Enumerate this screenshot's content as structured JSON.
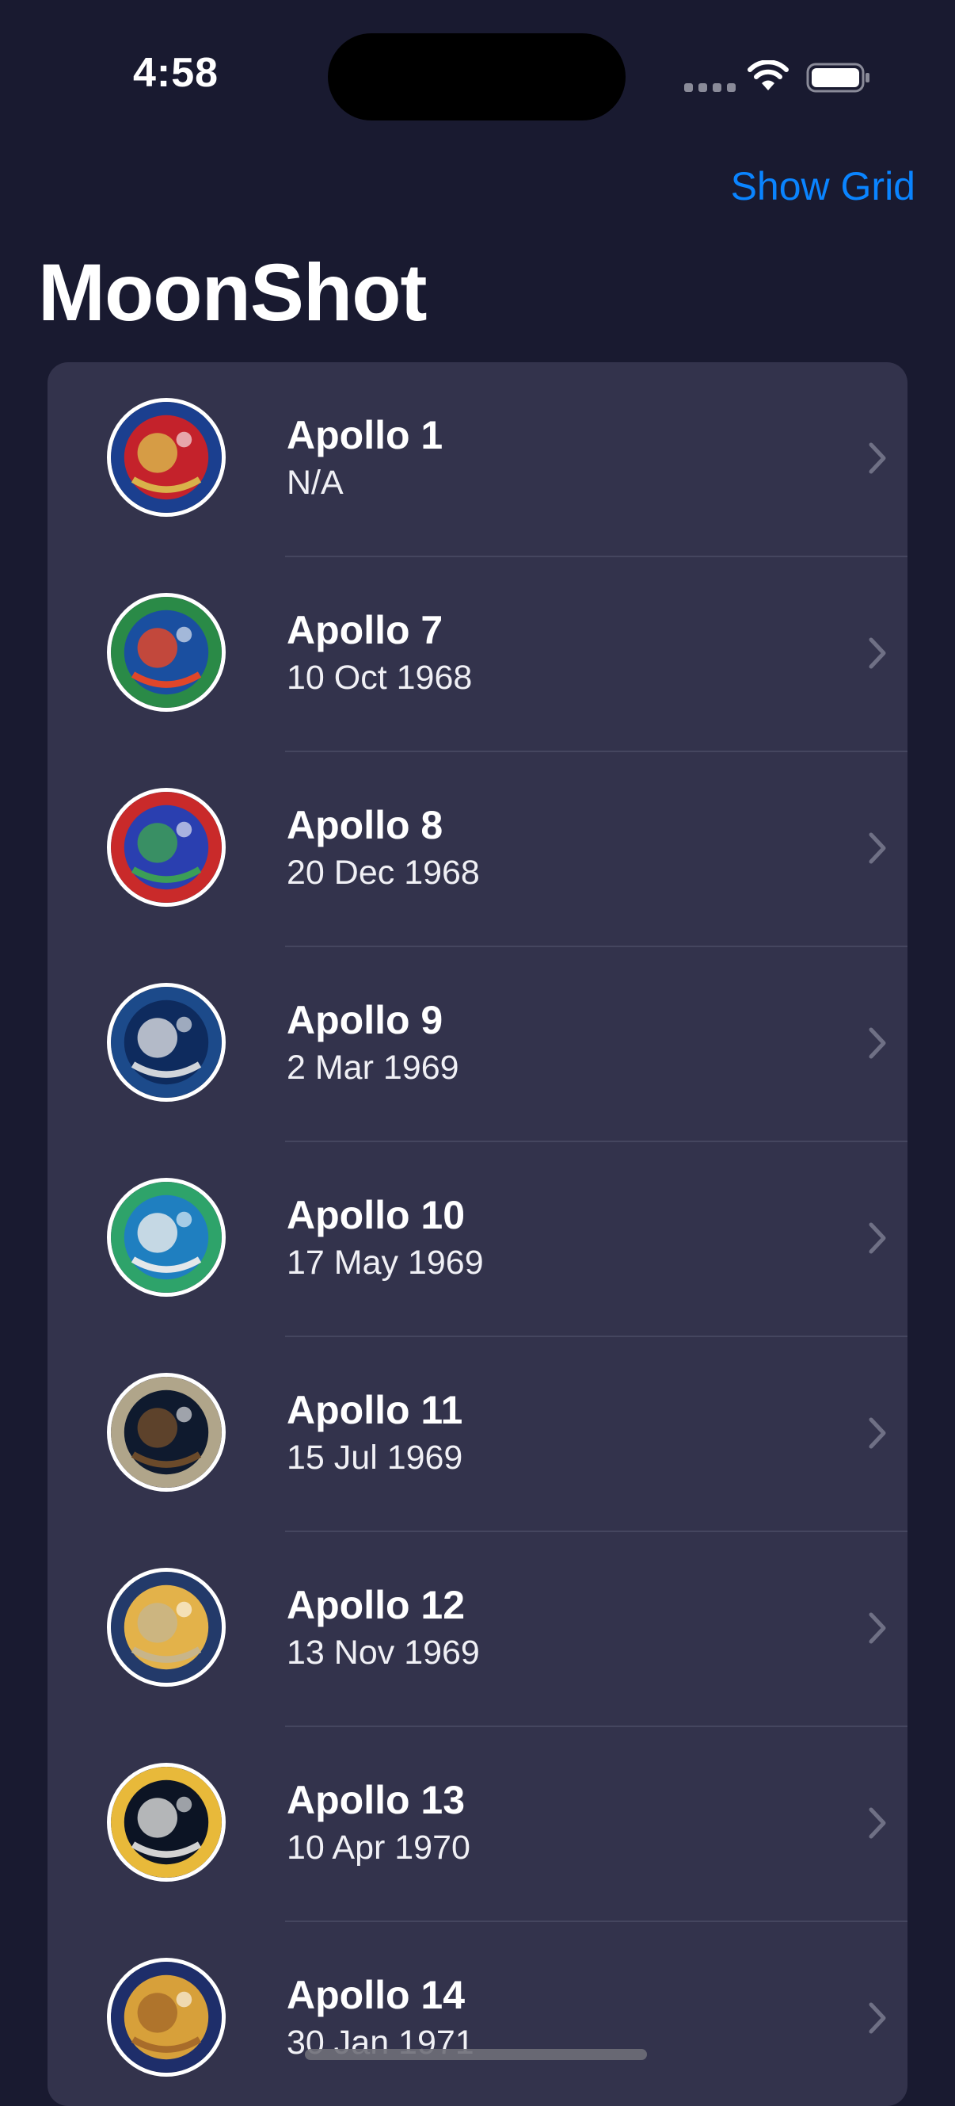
{
  "status_bar": {
    "time": "4:58"
  },
  "nav": {
    "show_grid_label": "Show Grid",
    "title": "MoonShot"
  },
  "missions": [
    {
      "title": "Apollo 1",
      "date": "N/A",
      "badge_colors": [
        "#c4222b",
        "#1b3f8f",
        "#d9b24a"
      ]
    },
    {
      "title": "Apollo 7",
      "date": "10 Oct 1968",
      "badge_colors": [
        "#1a4fa0",
        "#2a8a47",
        "#e0462a"
      ]
    },
    {
      "title": "Apollo 8",
      "date": "20 Dec 1968",
      "badge_colors": [
        "#2a3fb0",
        "#c92a2a",
        "#3c9e57"
      ]
    },
    {
      "title": "Apollo 9",
      "date": "2 Mar 1969",
      "badge_colors": [
        "#0e2b5e",
        "#1c4a8a",
        "#d0d4da"
      ]
    },
    {
      "title": "Apollo 10",
      "date": "17 May 1969",
      "badge_colors": [
        "#1f7fc0",
        "#2ea36a",
        "#e3e7ea"
      ]
    },
    {
      "title": "Apollo 11",
      "date": "15 Jul 1969",
      "badge_colors": [
        "#0f1a2e",
        "#b0a58a",
        "#6b4a2a"
      ]
    },
    {
      "title": "Apollo 12",
      "date": "13 Nov 1969",
      "badge_colors": [
        "#e3b24a",
        "#233a6a",
        "#c8b58a"
      ]
    },
    {
      "title": "Apollo 13",
      "date": "10 Apr 1970",
      "badge_colors": [
        "#0c1424",
        "#e8b93a",
        "#d2d2d2"
      ]
    },
    {
      "title": "Apollo 14",
      "date": "30 Jan 1971",
      "badge_colors": [
        "#d7a03a",
        "#1e2e6a",
        "#a86c2a"
      ]
    }
  ],
  "theme": {
    "background": "#191a30",
    "card": "#33334c",
    "accent": "#0a84ff"
  },
  "icons": {
    "wifi": "wifi-icon",
    "battery": "battery-icon",
    "chevron": "chevron-right-icon",
    "badge": "mission-badge-icon"
  }
}
